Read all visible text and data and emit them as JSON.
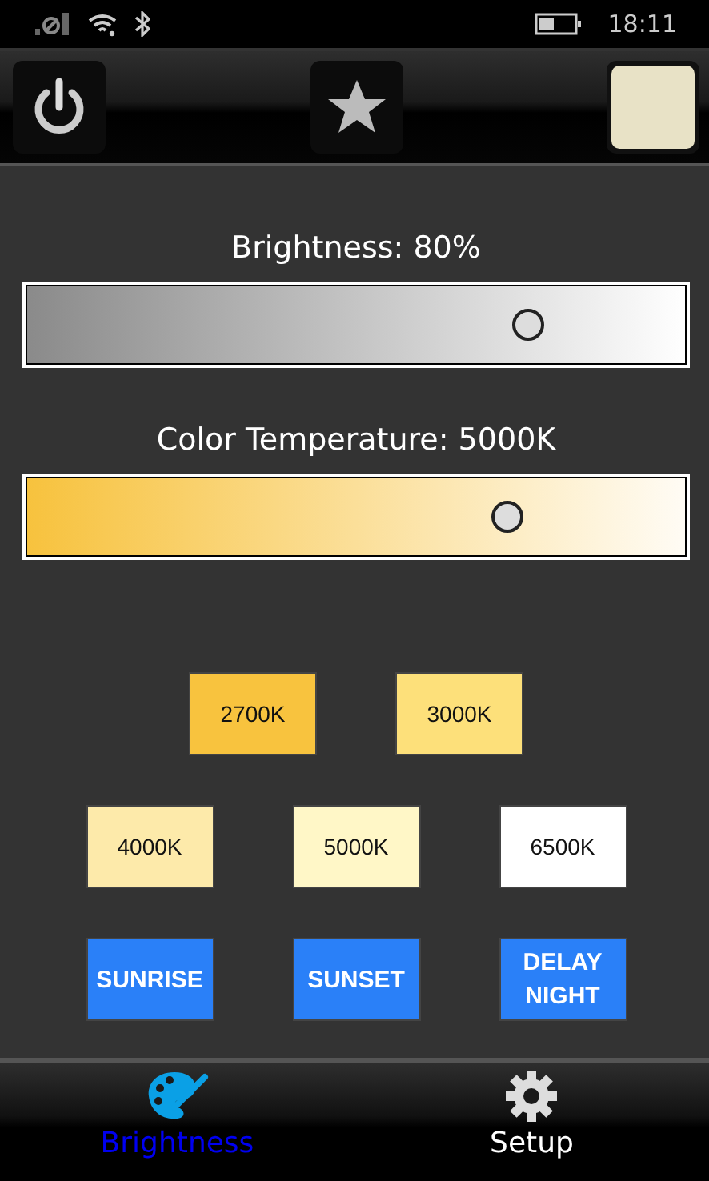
{
  "status_bar": {
    "time": "18:11"
  },
  "sliders": [
    {
      "label": "Brightness: 80%",
      "kind": "gray",
      "level": 0.76
    },
    {
      "label": "Color Temperature: 5000K",
      "kind": "warm",
      "level": 0.73
    }
  ],
  "presets": [
    [
      {
        "label": "2700K",
        "color": "#f8c33e"
      },
      {
        "label": "3000K",
        "color": "#fde07a"
      }
    ],
    [
      {
        "label": "4000K",
        "color": "#fdeaaa"
      },
      {
        "label": "5000K",
        "color": "#fff7c7"
      },
      {
        "label": "6500K",
        "color": "#ffffff"
      }
    ]
  ],
  "actions": [
    "SUNRISE",
    "SUNSET",
    "DELAY NIGHT"
  ],
  "tabs": [
    {
      "label": "Brightness",
      "kind": "palette",
      "selected": true
    },
    {
      "label": "Setup",
      "kind": "gear",
      "selected": false
    }
  ]
}
